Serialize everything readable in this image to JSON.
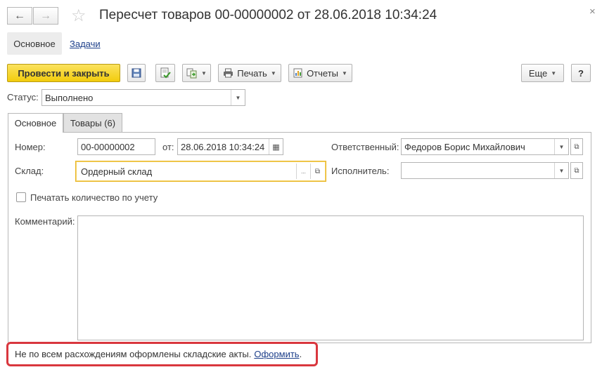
{
  "window": {
    "title": "Пересчет товаров 00-00000002 от 28.06.2018 10:34:24",
    "back_icon": "arrow-left",
    "forward_icon": "arrow-right",
    "favorite_icon": "star",
    "close_icon": "close"
  },
  "sections": {
    "main_label": "Основное",
    "tasks_label": "Задачи"
  },
  "toolbar": {
    "post_close_label": "Провести и закрыть",
    "save_icon": "floppy",
    "post_icon": "document-check",
    "create_based_icon": "create-based-on",
    "print_label": "Печать",
    "reports_label": "Отчеты",
    "more_label": "Еще",
    "help_label": "?"
  },
  "status": {
    "label": "Статус:",
    "value": "Выполнено"
  },
  "tabs": [
    {
      "label": "Основное",
      "active": true
    },
    {
      "label": "Товары (6)",
      "active": false
    }
  ],
  "form": {
    "number_label": "Номер:",
    "number_value": "00-00000002",
    "date_label": "от:",
    "date_value": "28.06.2018 10:34:24",
    "responsible_label": "Ответственный:",
    "responsible_value": "Федоров Борис Михайлович",
    "warehouse_label": "Склад:",
    "warehouse_value": "Ордерный склад",
    "executor_label": "Исполнитель:",
    "executor_value": "",
    "print_qty_label": "Печатать количество по учету",
    "print_qty_checked": false,
    "comment_label": "Комментарий:",
    "comment_value": ""
  },
  "notice": {
    "text": "Не по всем расхождениям оформлены складские акты.",
    "link": "Оформить",
    "end": "."
  },
  "colors": {
    "primary_button": "#f2cc0c",
    "notice_border": "#d9373e",
    "link": "#1d3f8a",
    "focus_border": "#e9b625"
  }
}
